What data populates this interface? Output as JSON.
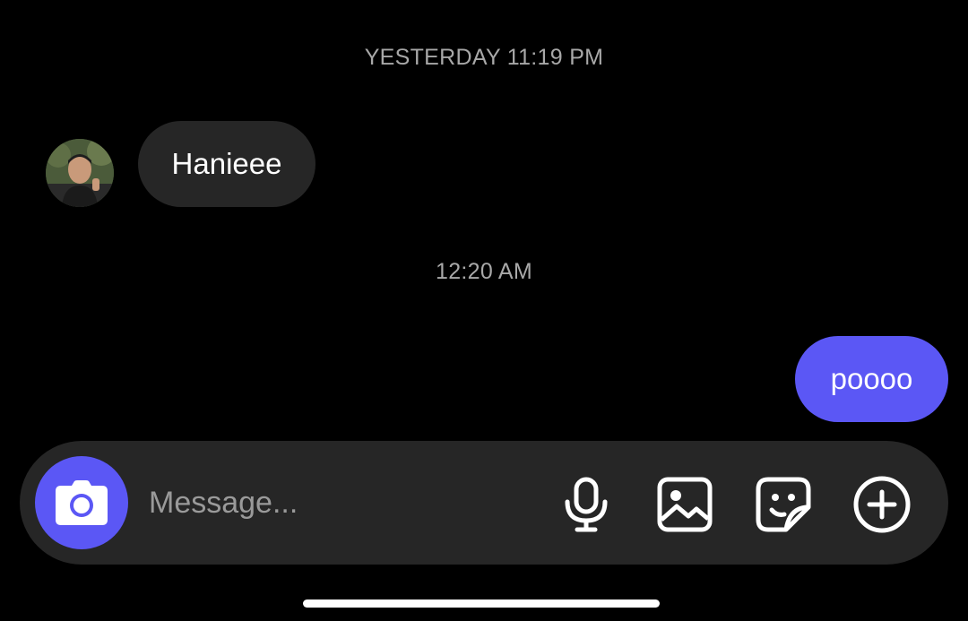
{
  "conversation": {
    "timestamps": [
      "YESTERDAY 11:19 PM",
      "12:20 AM"
    ],
    "messages": [
      {
        "direction": "incoming",
        "text": "Hanieee",
        "has_avatar": true
      },
      {
        "direction": "outgoing",
        "text": "poooo"
      }
    ]
  },
  "composer": {
    "placeholder": "Message...",
    "icons": [
      "camera-icon",
      "microphone-icon",
      "gallery-icon",
      "sticker-icon",
      "plus-circle-icon"
    ]
  },
  "colors": {
    "background": "#000000",
    "incoming_bubble": "#262626",
    "outgoing_bubble": "#5b57f5",
    "accent": "#5b57f5",
    "timestamp_text": "#a8a8a8",
    "composer_background": "#262626"
  }
}
